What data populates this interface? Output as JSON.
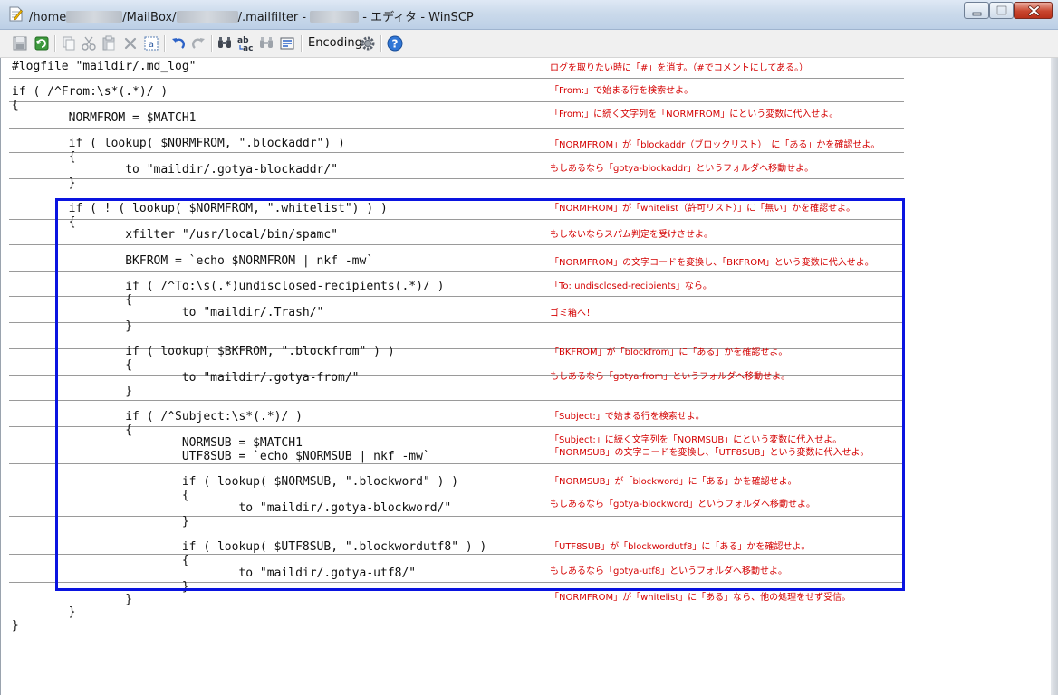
{
  "window": {
    "title_prefix": "/home",
    "title_seg1": "/MailBox/",
    "title_seg2": "/.mailfilter - ",
    "title_suffix": " - エディタ - WinSCP"
  },
  "toolbar": {
    "encoding_label": "Encoding",
    "buttons": [
      {
        "name": "save-icon"
      },
      {
        "name": "reload-icon"
      },
      {
        "name": "copy-icon"
      },
      {
        "name": "cut-icon"
      },
      {
        "name": "paste-icon"
      },
      {
        "name": "delete-icon"
      },
      {
        "name": "select-all-icon"
      },
      {
        "name": "undo-icon"
      },
      {
        "name": "redo-icon"
      },
      {
        "name": "find-icon"
      },
      {
        "name": "replace-icon"
      },
      {
        "name": "find-next-icon"
      },
      {
        "name": "goto-line-icon"
      },
      {
        "name": "settings-gear-icon"
      },
      {
        "name": "help-icon"
      }
    ]
  },
  "colors": {
    "annotation": "#d40000",
    "highlight_box": "#0a14e0",
    "code_text": "#111111"
  },
  "code_lines": [
    "#logfile \"maildir/.md_log\"",
    "if ( /^From:\\s*(.*)/ )",
    "{",
    "        NORMFROM = $MATCH1",
    "        if ( lookup( $NORMFROM, \".blockaddr\") )",
    "        {",
    "                to \"maildir/.gotya-blockaddr/\"",
    "        }",
    "        if ( ! ( lookup( $NORMFROM, \".whitelist\") ) )",
    "        {",
    "                xfilter \"/usr/local/bin/spamc\"",
    "                BKFROM = `echo $NORMFROM | nkf -mw`",
    "                if ( /^To:\\s(.*)undisclosed-recipients(.*)/ )",
    "                {",
    "                        to \"maildir/.Trash/\"",
    "                }",
    "                if ( lookup( $BKFROM, \".blockfrom\" ) )",
    "                {",
    "                        to \"maildir/.gotya-from/\"",
    "                }",
    "                if ( /^Subject:\\s*(.*)/ )",
    "                {",
    "                        NORMSUB = $MATCH1",
    "                        UTF8SUB = `echo $NORMSUB | nkf -mw`",
    "                        if ( lookup( $NORMSUB, \".blockword\" ) )",
    "                        {",
    "                                to \"maildir/.gotya-blockword/\"",
    "                        }",
    "                        if ( lookup( $UTF8SUB, \".blockwordutf8\" ) )",
    "                        {",
    "                                to \"maildir/.gotya-utf8/\"",
    "                        }",
    "                }",
    "        }",
    "}"
  ],
  "annotations": [
    "ログを取りたい時に「#」を消す。（#でコメントにしてある。）",
    "「From:」で始まる行を検索せよ。",
    "「From;」に続く文字列を「NORMFROM」にという変数に代入せよ。",
    "「NORMFROM」が「blockaddr（ブロックリスト）」に「ある」かを確認せよ。",
    "もしあるなら「gotya-blockaddr」というフォルダへ移動せよ。",
    "「NORMFROM」が「whitelist（許可リスト）」に「無い」かを確認せよ。",
    "もしないならスパム判定を受けさせよ。",
    "「NORMFROM」の文字コードを変換し、「BKFROM」という変数に代入せよ。",
    "「To: undisclosed-recipients」なら。",
    "ゴミ箱へ！",
    "「BKFROM」が「blockfrom」に「ある」かを確認せよ。",
    "もしあるなら「gotya-from」というフォルダへ移動せよ。",
    "「Subject:」で始まる行を検索せよ。",
    "「Subject:」に続く文字列を「NORMSUB」にという変数に代入せよ。",
    "「NORMSUB」の文字コードを変換し、「UTF8SUB」という変数に代入せよ。",
    "「NORMSUB」が「blockword」に「ある」かを確認せよ。",
    "もしあるなら「gotya-blockword」というフォルダへ移動せよ。",
    "「UTF8SUB」が「blockwordutf8」に「ある」かを確認せよ。",
    "もしあるなら「gotya-utf8」というフォルダへ移動せよ。",
    "「NORMFROM」が「whitelist」に「ある」なら、他の処理をせず受信。"
  ]
}
